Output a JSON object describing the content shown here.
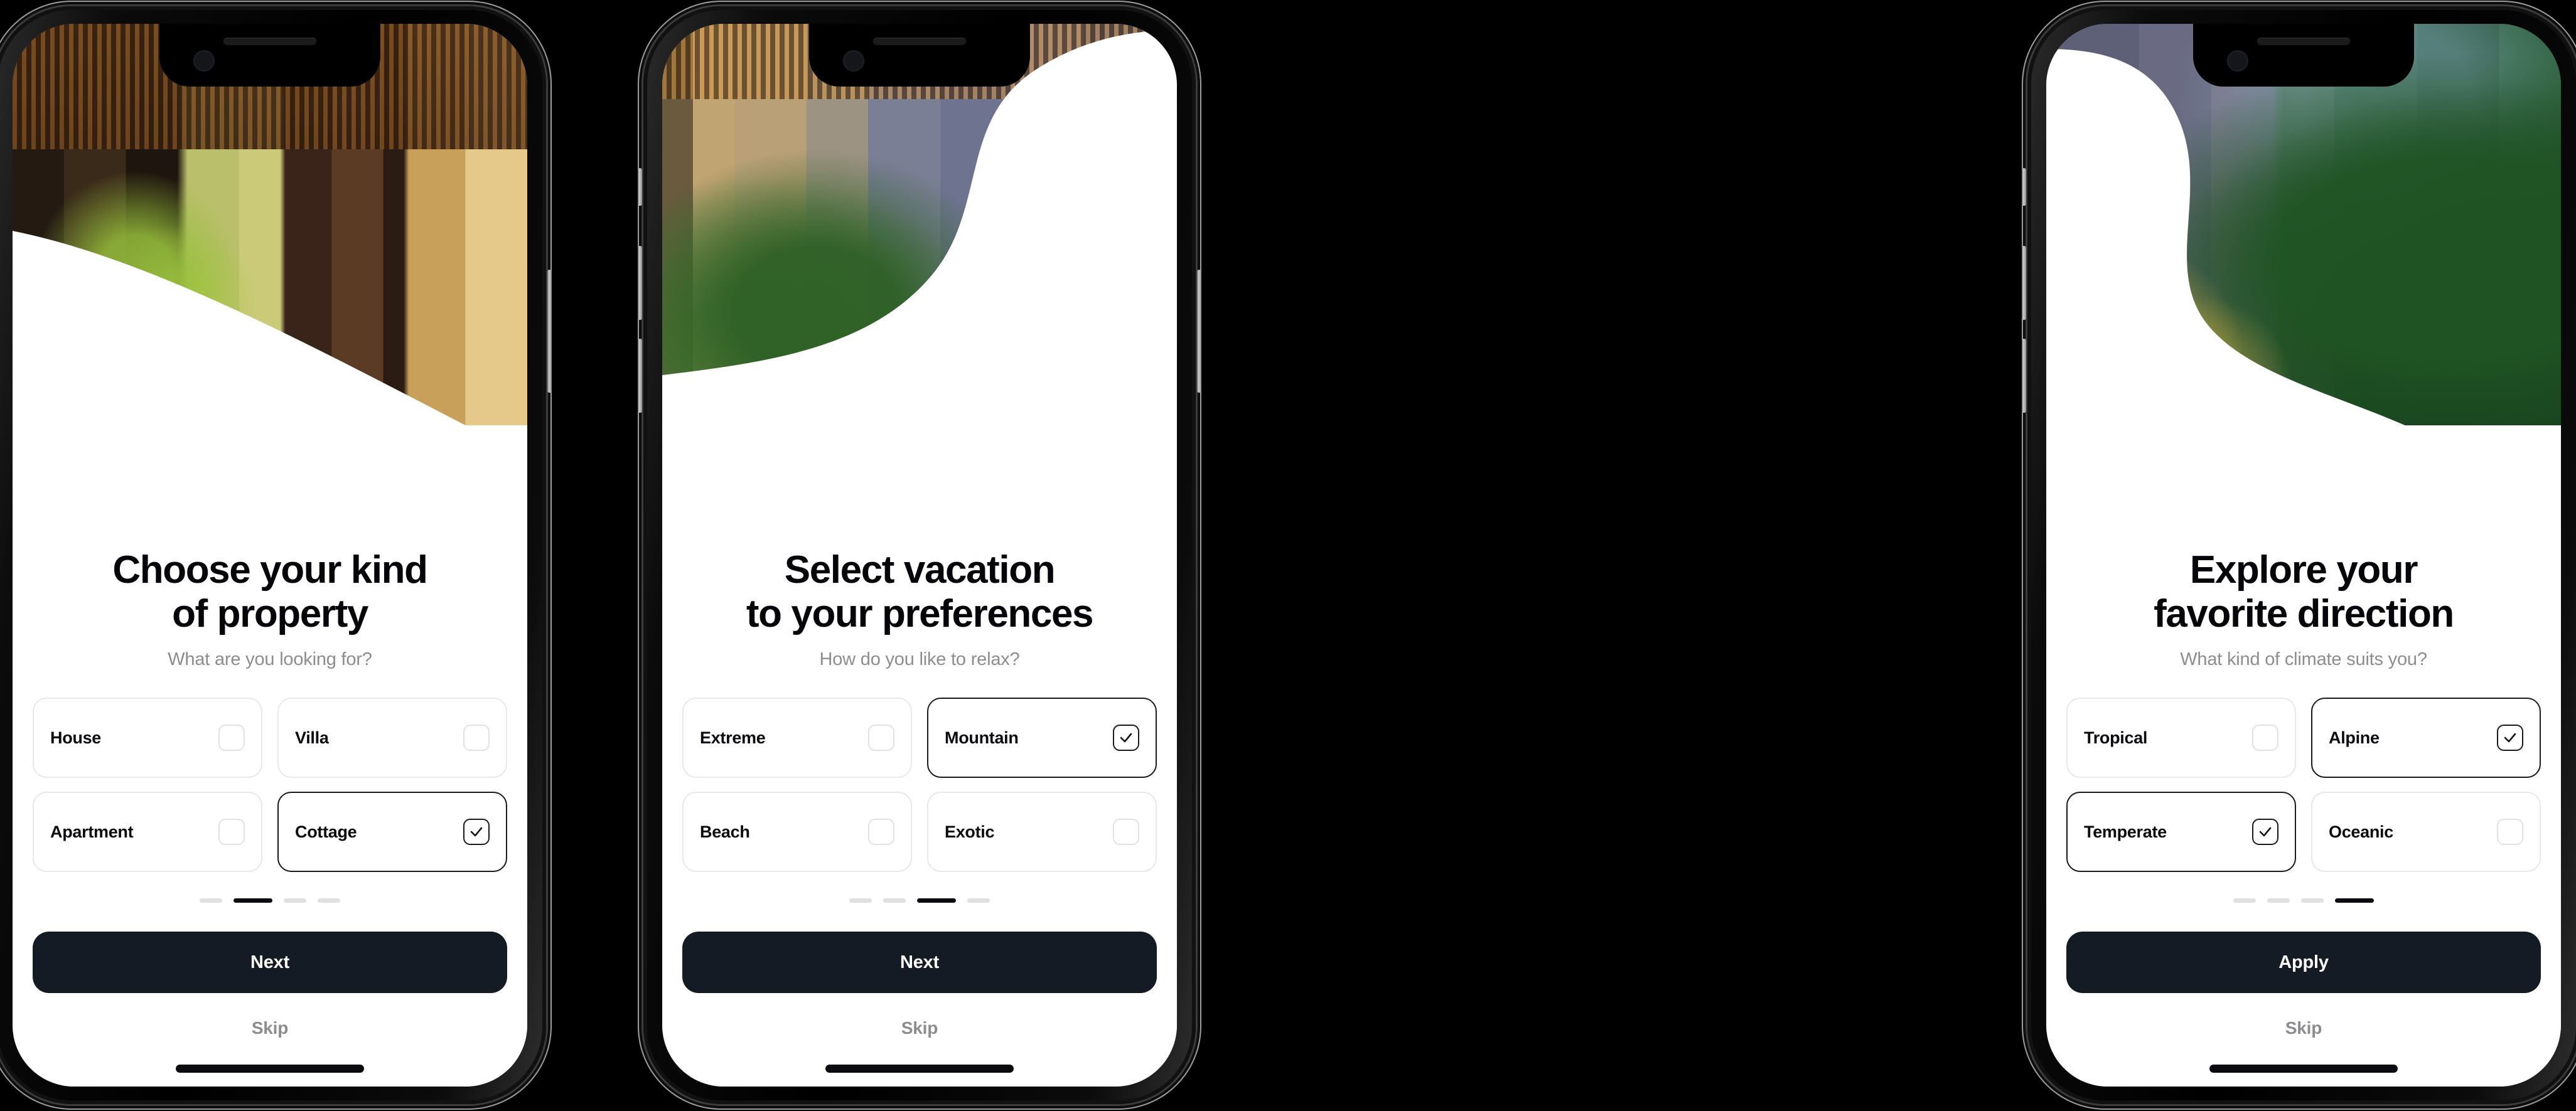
{
  "background_color": "#000000",
  "theme": {
    "accent_dark": "#151b24",
    "selected_border": "#1a1a1e",
    "idle_border": "#e8e8e8",
    "muted_text": "#8d8d90",
    "title_text": "#06060a"
  },
  "screens": [
    {
      "id": "property-type",
      "title": "Choose your kind\nof property",
      "subtitle": "What are you looking for?",
      "options": [
        {
          "label": "House",
          "checked": false
        },
        {
          "label": "Villa",
          "checked": false
        },
        {
          "label": "Apartment",
          "checked": false
        },
        {
          "label": "Cottage",
          "checked": true
        }
      ],
      "pagination": {
        "total": 4,
        "active_index": 1
      },
      "primary_button": "Next",
      "skip_label": "Skip",
      "hero_photo": "warm-timber-house-at-dusk"
    },
    {
      "id": "vacation-style",
      "title": "Select vacation\nto your preferences",
      "subtitle": "How do you like to relax?",
      "options": [
        {
          "label": "Extreme",
          "checked": false
        },
        {
          "label": "Mountain",
          "checked": true
        },
        {
          "label": "Beach",
          "checked": false
        },
        {
          "label": "Exotic",
          "checked": false
        }
      ],
      "pagination": {
        "total": 4,
        "active_index": 2
      },
      "primary_button": "Next",
      "skip_label": "Skip",
      "hero_photo": "concrete-courtyard-with-plants"
    },
    {
      "id": "climate-direction",
      "title": "Explore your\nfavorite direction",
      "subtitle": "What kind of climate suits you?",
      "options": [
        {
          "label": "Tropical",
          "checked": false
        },
        {
          "label": "Alpine",
          "checked": true
        },
        {
          "label": "Temperate",
          "checked": true
        },
        {
          "label": "Oceanic",
          "checked": false
        }
      ],
      "pagination": {
        "total": 4,
        "active_index": 3
      },
      "primary_button": "Apply",
      "skip_label": "Skip",
      "hero_photo": "concrete-wall-with-jungle-canopy"
    }
  ]
}
